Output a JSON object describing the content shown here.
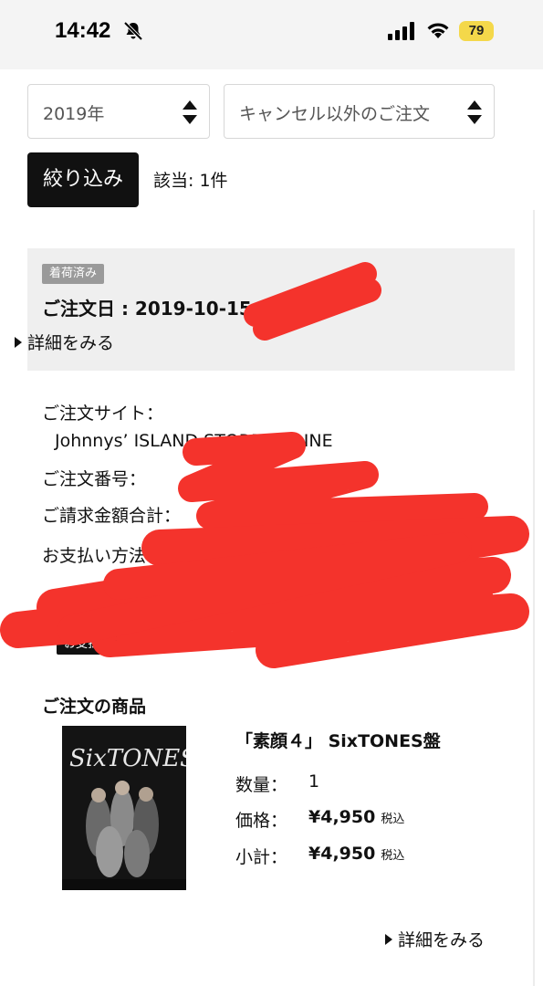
{
  "status_bar": {
    "time": "14:42",
    "battery": "79"
  },
  "filters": {
    "year": "2019年",
    "status": "キャンセル以外のご注文",
    "filter_button": "絞り込み",
    "result_count": "該当: 1件"
  },
  "order": {
    "status_badge": "着荷済み",
    "order_date": "ご注文日 : 2019-10-15",
    "detail_link": "詳細をみる"
  },
  "order_info": {
    "site_label": "ご注文サイト：",
    "site_value": "Johnnys’ ISLAND STORE ONLINE",
    "number_label": "ご注文番号：",
    "amount_label": "ご請求金額合計：",
    "payment_label": "お支払い方法",
    "paid_badge": "お支払い済み"
  },
  "products": {
    "section_title": "ご注文の商品",
    "items": [
      {
        "name": "「素顔４」 SixTONES盤",
        "quantity_label": "数量：",
        "quantity": "1",
        "price_label": "価格：",
        "price": "¥4,950",
        "price_tax": "税込",
        "subtotal_label": "小計：",
        "subtotal": "¥4,950",
        "subtotal_tax": "税込",
        "cover_text": "SixTONES"
      }
    ],
    "detail_link": "詳細をみる"
  },
  "colors": {
    "redaction": "#f4332c",
    "accent_dark": "#111111",
    "card_bg": "#efefef"
  }
}
